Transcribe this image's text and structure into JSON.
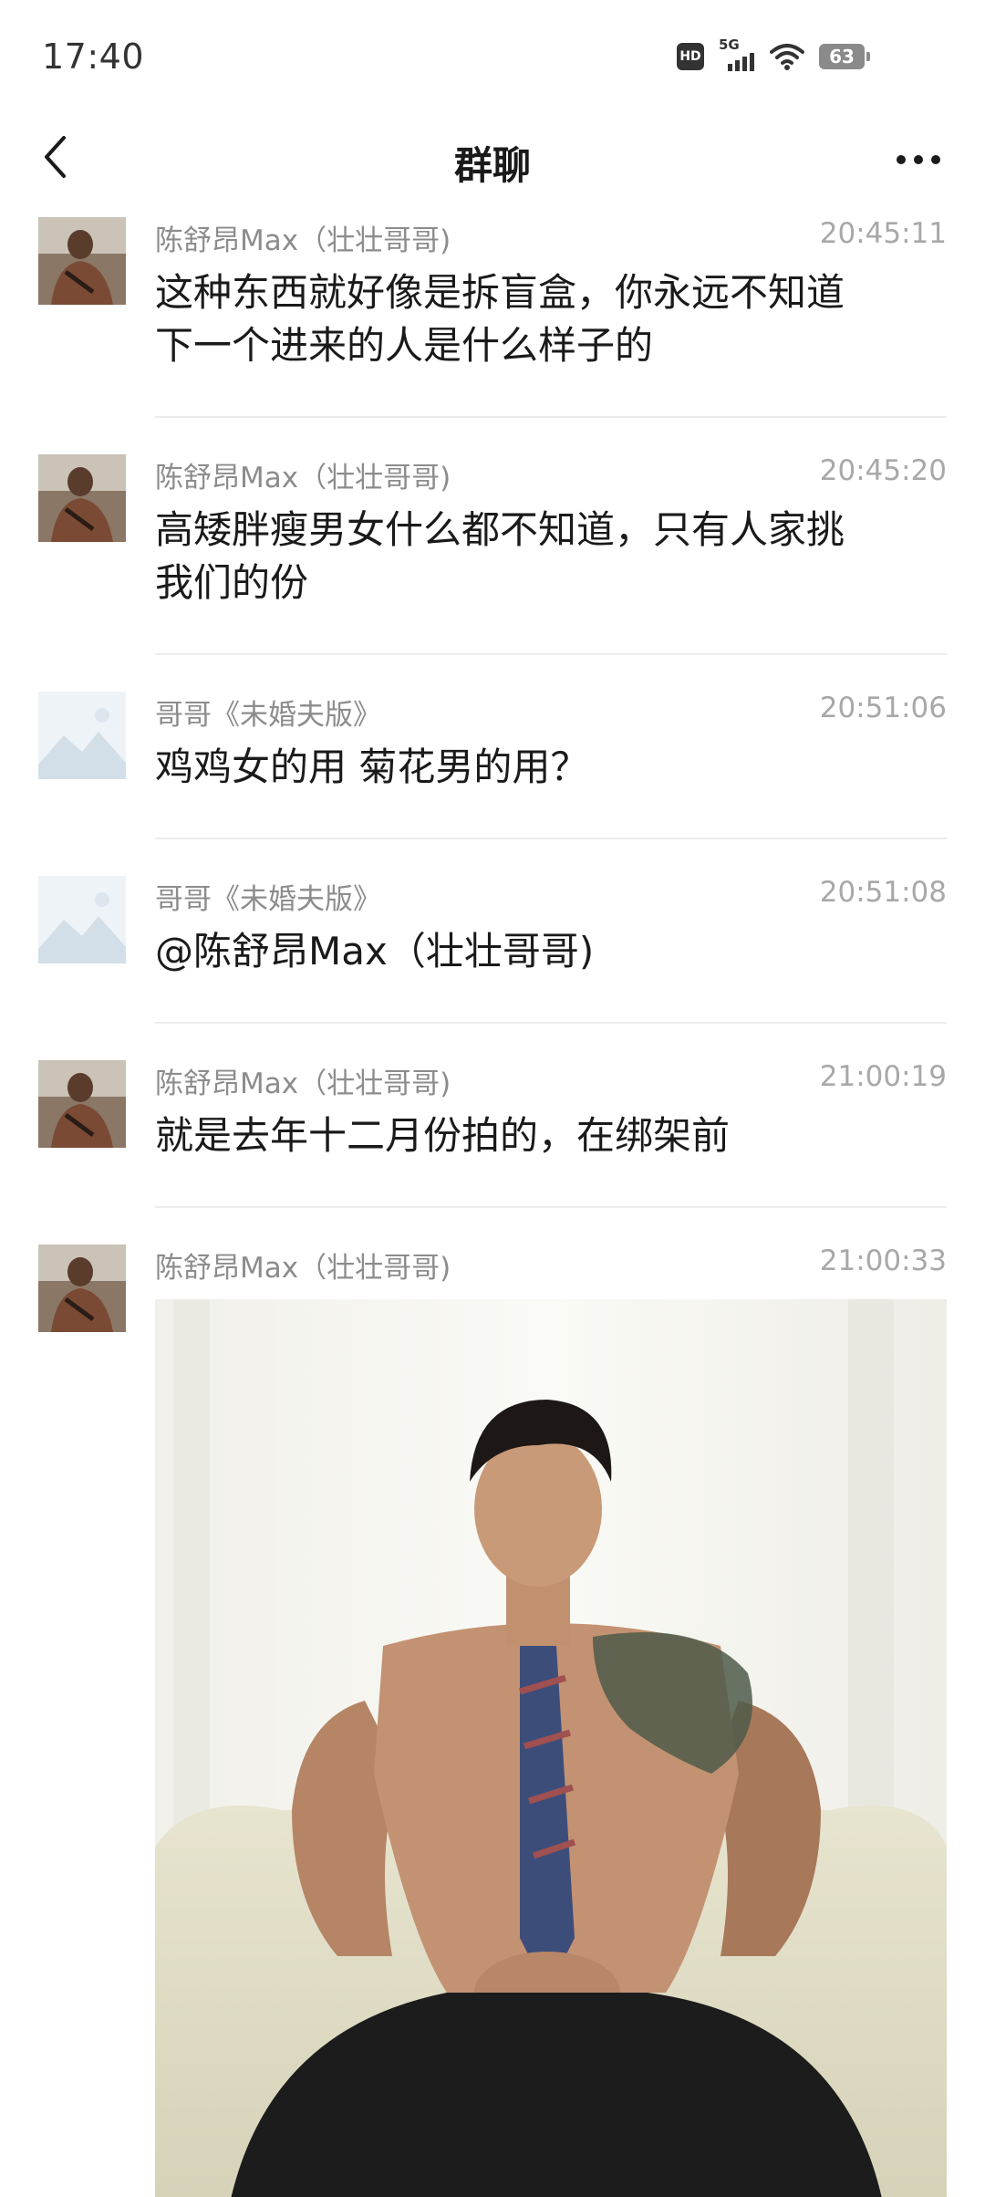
{
  "status_bar": {
    "time": "17:40",
    "hd_label": "HD",
    "network": "5G",
    "battery": "63",
    "icons": [
      "hd-icon",
      "signal-icon",
      "wifi-icon",
      "battery-icon"
    ]
  },
  "nav": {
    "title": "群聊",
    "back_icon": "chevron-left-icon",
    "more_icon": "more-dots-icon"
  },
  "messages": [
    {
      "sender": "陈舒昂Max（壮壮哥哥)",
      "time": "20:45:11",
      "lines": [
        "这种东西就好像是拆盲盒，你永远不知道",
        "下一个进来的人是什么样子的"
      ]
    },
    {
      "sender": "陈舒昂Max（壮壮哥哥)",
      "time": "20:45:20",
      "lines": [
        "高矮胖瘦男女什么都不知道，只有人家挑",
        "我们的份"
      ]
    },
    {
      "sender": "哥哥《未婚夫版》",
      "time": "20:51:06",
      "lines": [
        "鸡鸡女的用 菊花男的用？"
      ]
    },
    {
      "sender": "哥哥《未婚夫版》",
      "time": "20:51:08",
      "lines": [
        "@陈舒昂Max（壮壮哥哥)"
      ]
    },
    {
      "sender": "陈舒昂Max（壮壮哥哥)",
      "time": "21:00:19",
      "lines": [
        "就是去年十二月份拍的，在绑架前"
      ]
    },
    {
      "sender": "陈舒昂Max（壮壮哥哥)",
      "time": "21:00:33",
      "lines": []
    }
  ],
  "colors": {
    "text_primary": "#1a1a1a",
    "text_meta": "#8c8c8c",
    "time_text": "#a8a8a8",
    "divider": "#ececec",
    "background": "#ffffff"
  }
}
